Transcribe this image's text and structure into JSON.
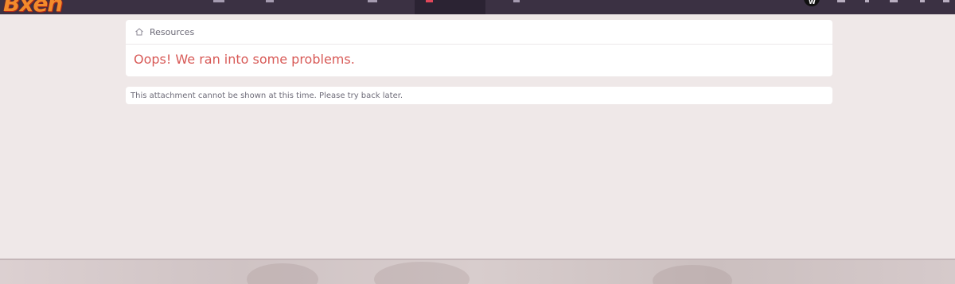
{
  "header": {
    "logo_text": "Bxen"
  },
  "breadcrumb": {
    "items": [
      "Resources"
    ]
  },
  "error": {
    "title": "Oops! We ran into some problems.",
    "message": "This attachment cannot be shown at this time. Please try back later."
  },
  "colors": {
    "topbar": "#3b3143",
    "page_background": "#efe8e8",
    "error_title": "#d85a57",
    "muted_text": "#6d6b78",
    "nav_active_accent": "#e2475a"
  },
  "icons": [
    "home-icon"
  ]
}
